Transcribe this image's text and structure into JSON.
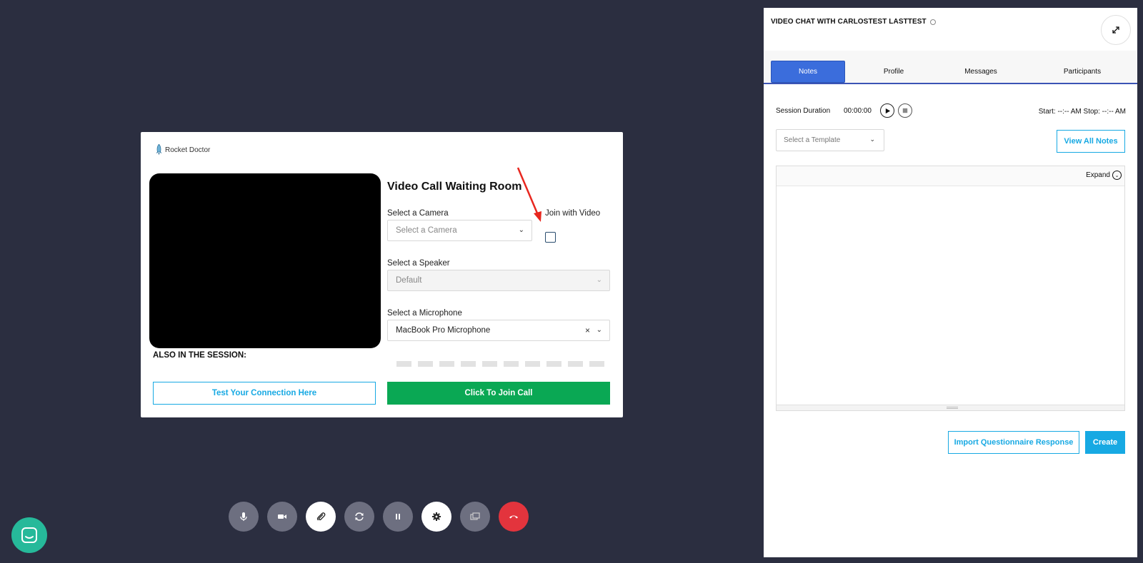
{
  "waiting_room": {
    "logo_text": "Rocket Doctor",
    "title": "Video Call Waiting Room",
    "also_in_session_label": "ALSO IN THE SESSION:",
    "camera": {
      "label": "Select a Camera",
      "placeholder": "Select a Camera"
    },
    "join_with_video": {
      "label": "Join with Video",
      "checked": false
    },
    "speaker": {
      "label": "Select a Speaker",
      "value": "Default"
    },
    "microphone": {
      "label": "Select a Microphone",
      "value": "MacBook Pro Microphone",
      "clear_glyph": "×"
    },
    "test_connection_label": "Test Your Connection Here",
    "join_call_label": "Click To Join Call",
    "colors": {
      "join": "#0aa854",
      "outline": "#17a9e3",
      "annotation_arrow": "#e8271f"
    }
  },
  "toolbar": {
    "buttons": [
      {
        "icon": "microphone-icon"
      },
      {
        "icon": "video-camera-icon"
      },
      {
        "icon": "paperclip-icon"
      },
      {
        "icon": "refresh-icon"
      },
      {
        "icon": "pause-icon"
      },
      {
        "icon": "gear-icon"
      },
      {
        "icon": "screen-share-icon"
      },
      {
        "icon": "hang-up-icon"
      }
    ]
  },
  "panel": {
    "title": "VIDEO CHAT WITH CARLOSTEST LASTTEST",
    "tabs": [
      {
        "label": "Notes",
        "active": true
      },
      {
        "label": "Profile",
        "active": false
      },
      {
        "label": "Messages",
        "active": false
      },
      {
        "label": "Participants",
        "active": false
      }
    ],
    "session_duration_label": "Session Duration",
    "session_time": "00:00:00",
    "start_stop": "Start: --:-- AM Stop: --:-- AM",
    "template_placeholder": "Select a Template",
    "view_all_notes_label": "View All Notes",
    "editor_expand_label": "Expand",
    "import_label": "Import Questionnaire Response",
    "create_label": "Create",
    "colors": {
      "active_tab": "#3b6ddc",
      "accent": "#17a9e3"
    }
  }
}
